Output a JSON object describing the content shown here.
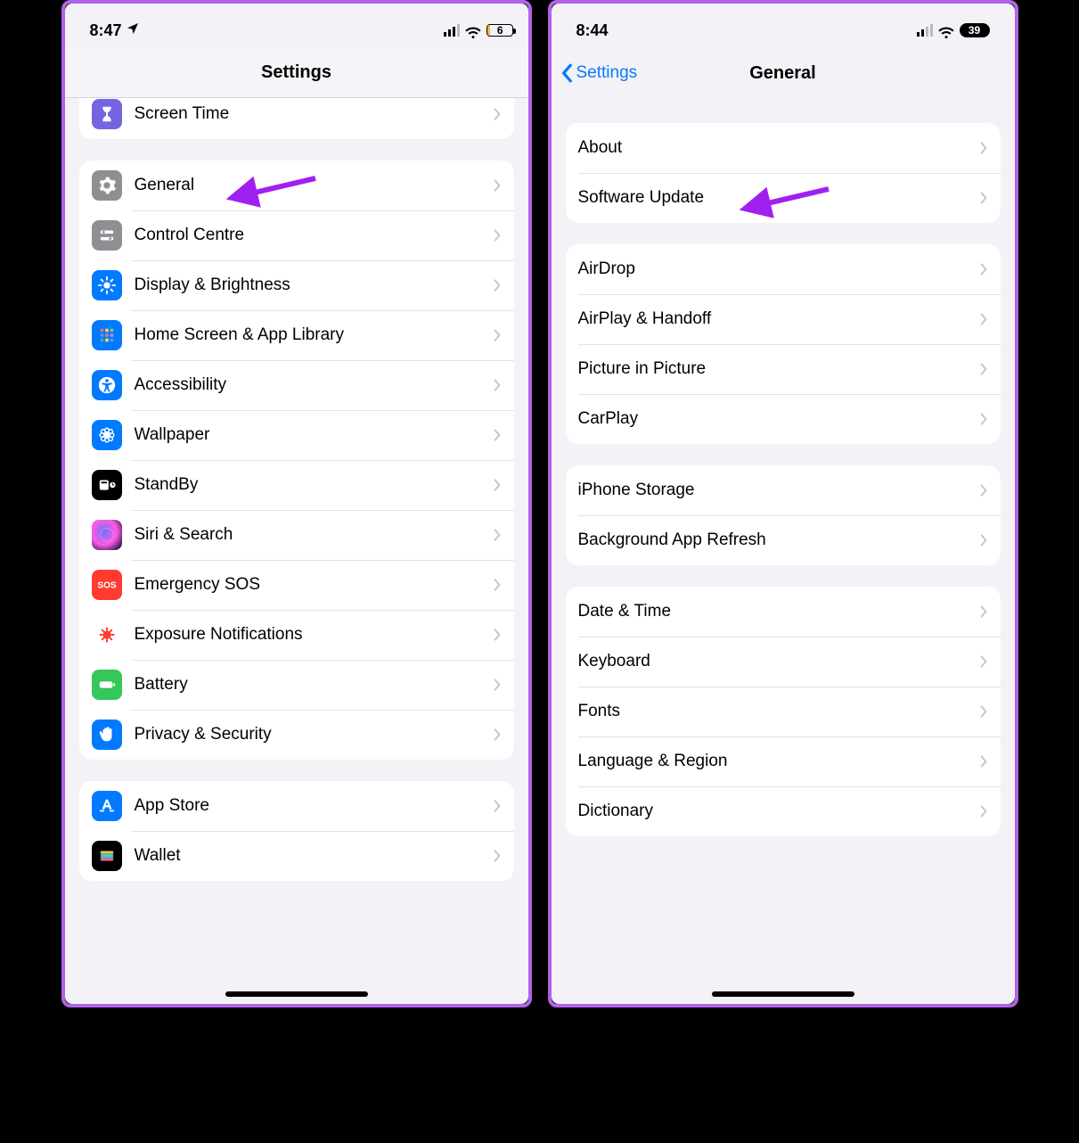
{
  "colors": {
    "accent_blue": "#0a7aff",
    "annotation": "#a020f0",
    "gray_chevron": "#c6c6cb"
  },
  "left_phone": {
    "status": {
      "time": "8:47",
      "battery": "6",
      "location_arrow": true
    },
    "header": {
      "title": "Settings"
    },
    "sections": [
      {
        "id": "top",
        "partial": true,
        "rows": [
          {
            "id": "screen-time",
            "label": "Screen Time",
            "icon": "hourglass-icon",
            "icon_bg": "bg-purple"
          }
        ]
      },
      {
        "id": "main",
        "rows": [
          {
            "id": "general",
            "label": "General",
            "icon": "gear-icon",
            "icon_bg": "bg-gray",
            "annot": true
          },
          {
            "id": "control-centre",
            "label": "Control Centre",
            "icon": "sliders-icon",
            "icon_bg": "bg-gray"
          },
          {
            "id": "display-brightness",
            "label": "Display & Brightness",
            "icon": "sun-icon",
            "icon_bg": "bg-blue"
          },
          {
            "id": "home-screen",
            "label": "Home Screen & App Library",
            "icon": "grid-icon",
            "icon_bg": "bg-blue"
          },
          {
            "id": "accessibility",
            "label": "Accessibility",
            "icon": "accessibility-icon",
            "icon_bg": "bg-blue"
          },
          {
            "id": "wallpaper",
            "label": "Wallpaper",
            "icon": "flower-icon",
            "icon_bg": "bg-blue"
          },
          {
            "id": "standby",
            "label": "StandBy",
            "icon": "standby-icon",
            "icon_bg": "bg-black"
          },
          {
            "id": "siri-search",
            "label": "Siri & Search",
            "icon": "siri-icon",
            "icon_bg": "siri-bg"
          },
          {
            "id": "emergency-sos",
            "label": "Emergency SOS",
            "icon": "sos-icon",
            "icon_bg": "bg-red"
          },
          {
            "id": "exposure-notifications",
            "label": "Exposure Notifications",
            "icon": "virus-icon",
            "icon_bg": "bg-white"
          },
          {
            "id": "battery",
            "label": "Battery",
            "icon": "battery-icon",
            "icon_bg": "bg-green"
          },
          {
            "id": "privacy-security",
            "label": "Privacy & Security",
            "icon": "hand-icon",
            "icon_bg": "bg-blue"
          }
        ]
      },
      {
        "id": "store",
        "rows": [
          {
            "id": "app-store",
            "label": "App Store",
            "icon": "appstore-icon",
            "icon_bg": "bg-blue"
          },
          {
            "id": "wallet",
            "label": "Wallet",
            "icon": "wallet-icon",
            "icon_bg": "bg-black"
          }
        ]
      }
    ]
  },
  "right_phone": {
    "status": {
      "time": "8:44",
      "battery": "39"
    },
    "header": {
      "back_label": "Settings",
      "title": "General"
    },
    "sections": [
      {
        "id": "g1",
        "rows": [
          {
            "id": "about",
            "label": "About"
          },
          {
            "id": "software-update",
            "label": "Software Update",
            "annot": true
          }
        ]
      },
      {
        "id": "g2",
        "rows": [
          {
            "id": "airdrop",
            "label": "AirDrop"
          },
          {
            "id": "airplay-handoff",
            "label": "AirPlay & Handoff"
          },
          {
            "id": "picture-in-picture",
            "label": "Picture in Picture"
          },
          {
            "id": "carplay",
            "label": "CarPlay"
          }
        ]
      },
      {
        "id": "g3",
        "rows": [
          {
            "id": "iphone-storage",
            "label": "iPhone Storage"
          },
          {
            "id": "background-refresh",
            "label": "Background App Refresh"
          }
        ]
      },
      {
        "id": "g4",
        "rows": [
          {
            "id": "date-time",
            "label": "Date & Time"
          },
          {
            "id": "keyboard",
            "label": "Keyboard"
          },
          {
            "id": "fonts",
            "label": "Fonts"
          },
          {
            "id": "language-region",
            "label": "Language & Region"
          },
          {
            "id": "dictionary",
            "label": "Dictionary"
          }
        ]
      }
    ]
  }
}
